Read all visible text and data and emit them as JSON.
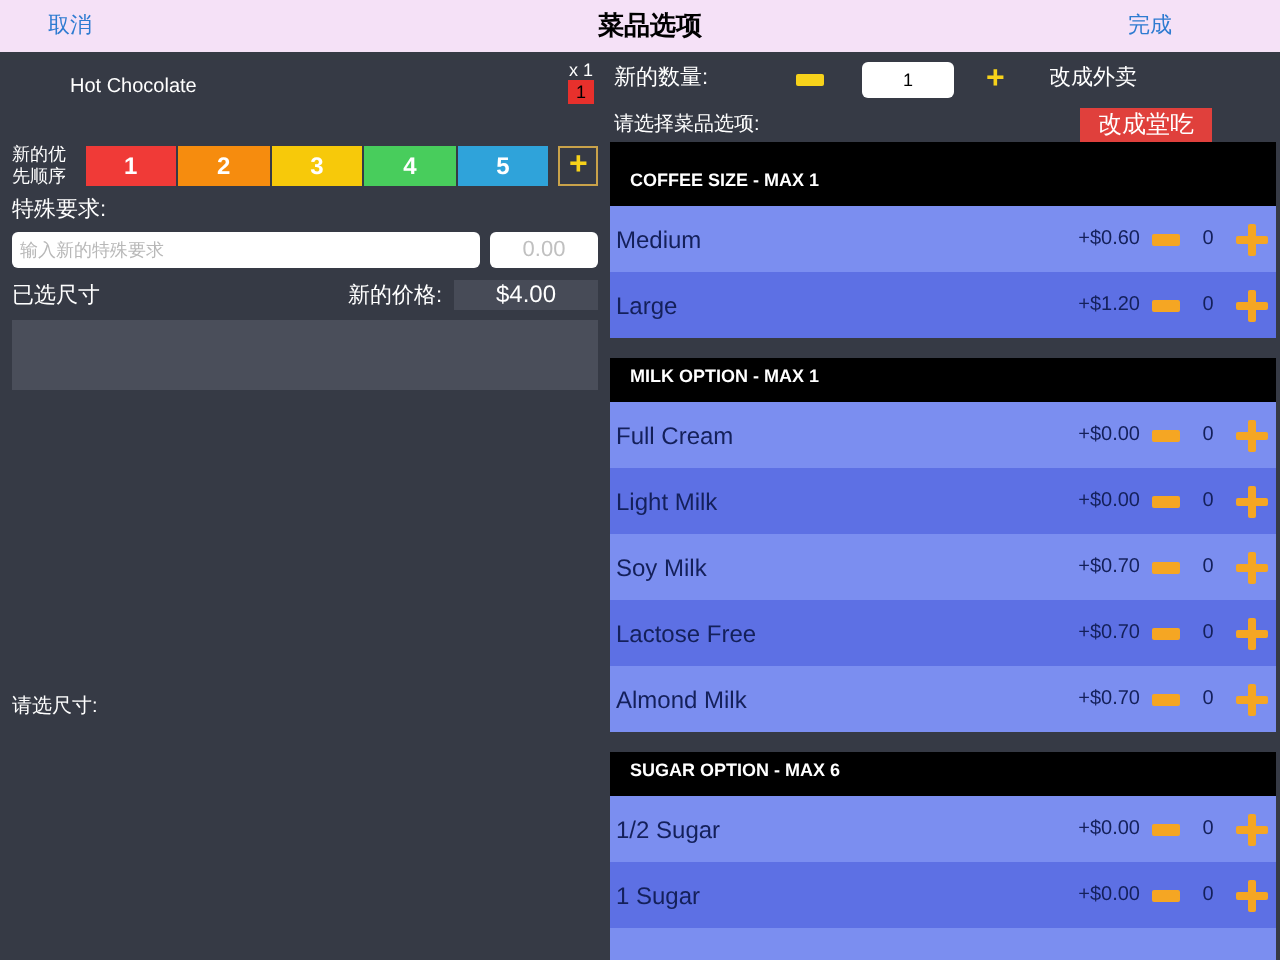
{
  "top_bar": {
    "cancel": "取消",
    "title": "菜品选项",
    "done": "完成"
  },
  "item": {
    "name": "Hot Chocolate",
    "quantity_label": "x 1",
    "quantity_badge": "1"
  },
  "priority": {
    "label": "新的优先顺序",
    "options": [
      {
        "label": "1",
        "color": "#f03a37"
      },
      {
        "label": "2",
        "color": "#f68c0e"
      },
      {
        "label": "3",
        "color": "#f7c90a"
      },
      {
        "label": "4",
        "color": "#48cd5c"
      },
      {
        "label": "5",
        "color": "#2fa3da"
      }
    ],
    "add": "+"
  },
  "special_request": {
    "label": "特殊要求:",
    "placeholder": "输入新的特殊要求",
    "price_placeholder": "0.00"
  },
  "selected_size": {
    "label": "已选尺寸",
    "price_label": "新的价格:",
    "price": "$4.00"
  },
  "choose_size_label": "请选尺寸:",
  "quantity": {
    "label": "新的数量:",
    "value": "1",
    "plus": "+",
    "takeaway": "改成外卖"
  },
  "options_label": "请选择菜品选项:",
  "dine_in_button": "改成堂吃",
  "sections": [
    {
      "title": "COFFEE SIZE - MAX 1",
      "tall": true,
      "rows": [
        {
          "name": "Medium",
          "price": "+$0.60",
          "count": "0"
        },
        {
          "name": "Large",
          "price": "+$1.20",
          "count": "0"
        }
      ]
    },
    {
      "title": "MILK OPTION - MAX 1",
      "tall": false,
      "rows": [
        {
          "name": "Full Cream",
          "price": "+$0.00",
          "count": "0"
        },
        {
          "name": "Light Milk",
          "price": "+$0.00",
          "count": "0"
        },
        {
          "name": "Soy Milk",
          "price": "+$0.70",
          "count": "0"
        },
        {
          "name": "Lactose Free",
          "price": "+$0.70",
          "count": "0"
        },
        {
          "name": "Almond Milk",
          "price": "+$0.70",
          "count": "0"
        }
      ]
    },
    {
      "title": "SUGAR OPTION - MAX 6",
      "tall": false,
      "rows": [
        {
          "name": "1/2 Sugar",
          "price": "+$0.00",
          "count": "0"
        },
        {
          "name": "1 Sugar",
          "price": "+$0.00",
          "count": "0"
        }
      ]
    }
  ]
}
